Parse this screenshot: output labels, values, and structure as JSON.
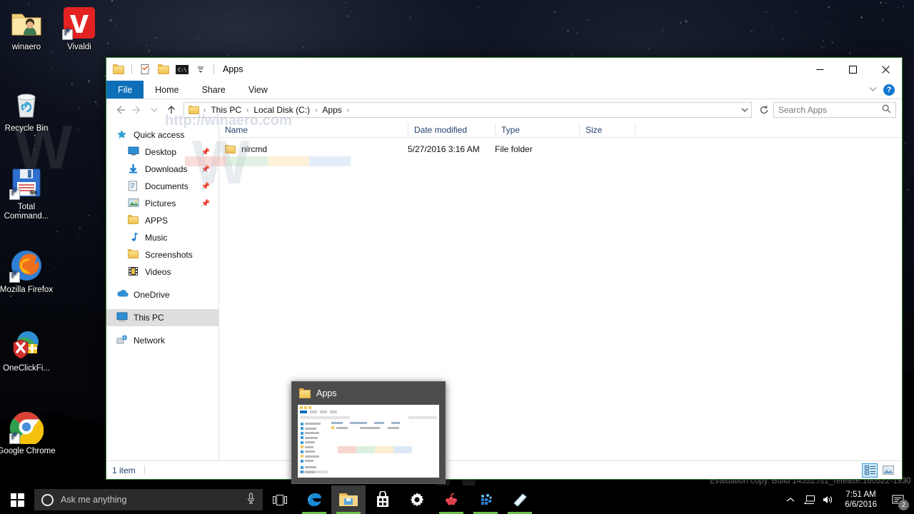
{
  "desktop": {
    "icons": [
      {
        "label": "winaero",
        "icon": "user-folder-icon"
      },
      {
        "label": "Vivaldi",
        "icon": "vivaldi-icon"
      },
      {
        "label": "Recycle Bin",
        "icon": "recycle-bin-icon"
      },
      {
        "label": "Total Command...",
        "icon": "total-commander-icon"
      },
      {
        "label": "Mozilla Firefox",
        "icon": "firefox-icon"
      },
      {
        "label": "OneClickFi...",
        "icon": "oneclickfirewall-icon"
      },
      {
        "label": "Google Chrome",
        "icon": "chrome-icon"
      }
    ],
    "evaluation_watermark": "Evaluation copy. Build 14352.rs1_release.160522-1930",
    "site_watermark": "http://winaero.com",
    "site_watermark_big": "W"
  },
  "explorer": {
    "title": "Apps",
    "quick_access_toolbar": [
      {
        "name": "folder-icon"
      },
      {
        "name": "properties-icon"
      },
      {
        "name": "new-folder-icon"
      },
      {
        "name": "command-prompt-icon"
      },
      {
        "name": "customize-dropdown-icon"
      }
    ],
    "window_controls": {
      "minimize": "—",
      "maximize": "☐",
      "close": "✕"
    },
    "ribbon": {
      "tabs": [
        {
          "label": "File",
          "active": true
        },
        {
          "label": "Home",
          "active": false
        },
        {
          "label": "Share",
          "active": false
        },
        {
          "label": "View",
          "active": false
        }
      ],
      "collapse_icon": "chevron-down-icon",
      "help_label": "?"
    },
    "address": {
      "back_icon": "back-arrow-icon",
      "forward_icon": "forward-arrow-icon",
      "recent_icon": "chevron-down-icon",
      "up_icon": "up-arrow-icon",
      "breadcrumbs": [
        "This PC",
        "Local Disk (C:)",
        "Apps"
      ],
      "dropdown_icon": "chevron-down-icon",
      "refresh_icon": "refresh-icon",
      "separator": "›"
    },
    "search": {
      "placeholder": "Search Apps",
      "icon": "search-icon"
    },
    "nav_pane": [
      {
        "label": "Quick access",
        "icon": "star-icon",
        "indent": false,
        "pinned": false,
        "selected": false
      },
      {
        "label": "Desktop",
        "icon": "desktop-icon",
        "indent": true,
        "pinned": true,
        "selected": false
      },
      {
        "label": "Downloads",
        "icon": "downloads-icon",
        "indent": true,
        "pinned": true,
        "selected": false
      },
      {
        "label": "Documents",
        "icon": "documents-icon",
        "indent": true,
        "pinned": true,
        "selected": false
      },
      {
        "label": "Pictures",
        "icon": "pictures-icon",
        "indent": true,
        "pinned": true,
        "selected": false
      },
      {
        "label": "APPS",
        "icon": "folder-icon",
        "indent": true,
        "pinned": false,
        "selected": false
      },
      {
        "label": "Music",
        "icon": "music-icon",
        "indent": true,
        "pinned": false,
        "selected": false
      },
      {
        "label": "Screenshots",
        "icon": "folder-icon",
        "indent": true,
        "pinned": false,
        "selected": false
      },
      {
        "label": "Videos",
        "icon": "videos-icon",
        "indent": true,
        "pinned": false,
        "selected": false
      },
      {
        "label": "OneDrive",
        "icon": "onedrive-icon",
        "indent": false,
        "pinned": false,
        "selected": false
      },
      {
        "label": "This PC",
        "icon": "this-pc-icon",
        "indent": false,
        "pinned": false,
        "selected": true
      },
      {
        "label": "Network",
        "icon": "network-icon",
        "indent": false,
        "pinned": false,
        "selected": false
      }
    ],
    "columns": [
      "Name",
      "Date modified",
      "Type",
      "Size"
    ],
    "rows": [
      {
        "name": "nircmd",
        "date_modified": "5/27/2016 3:16 AM",
        "type": "File folder",
        "size": ""
      }
    ],
    "status": {
      "item_count": "1 item"
    },
    "view_buttons": [
      {
        "name": "details-view-button",
        "active": true
      },
      {
        "name": "large-icons-view-button",
        "active": false
      }
    ]
  },
  "thumbnail_preview": {
    "title": "Apps",
    "icon": "folder-icon"
  },
  "taskbar": {
    "start_label": "Start",
    "cortana": {
      "placeholder": "Ask me anything",
      "mic_icon": "microphone-icon"
    },
    "task_view": "task-view-icon",
    "apps": [
      {
        "name": "edge-icon",
        "label": "Microsoft Edge",
        "active": false,
        "running": true
      },
      {
        "name": "file-explorer-icon",
        "label": "File Explorer",
        "active": true,
        "running": true
      },
      {
        "name": "store-icon",
        "label": "Store",
        "active": false,
        "running": false
      },
      {
        "name": "settings-icon",
        "label": "Settings",
        "active": false,
        "running": false
      },
      {
        "name": "raspberry-app-icon",
        "label": "App",
        "active": false,
        "running": true
      },
      {
        "name": "blue-cube-app-icon",
        "label": "App",
        "active": false,
        "running": true
      },
      {
        "name": "sticky-notes-icon",
        "label": "Sticky Notes",
        "active": false,
        "running": true
      }
    ],
    "tray": {
      "show_hidden_icon": "chevron-up-icon",
      "network_icon": "network-icon",
      "volume_icon": "volume-icon",
      "time": "7:51 AM",
      "date": "6/6/2016",
      "action_center_icon": "action-center-icon",
      "notification_count": "2"
    }
  },
  "colors": {
    "accent": "#0d6fb8",
    "window_border": "#2f7d32",
    "selection": "#dedede",
    "view_active": "#cce8f7",
    "running_underline": "#6cc04a",
    "taskbar": "#000000"
  }
}
